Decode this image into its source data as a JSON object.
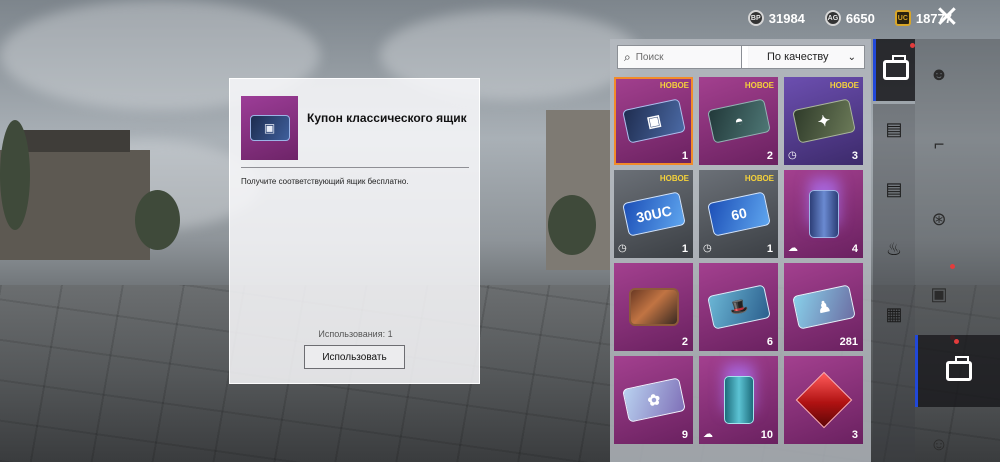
{
  "topbar": {
    "currencies": [
      {
        "icon": "bp-coin-icon",
        "code": "BP",
        "value": "31984"
      },
      {
        "icon": "silver-fragment-icon",
        "code": "AG",
        "value": "6650"
      },
      {
        "icon": "uc-coin-icon",
        "code": "UC",
        "value": "18777"
      }
    ],
    "close_icon": "close-icon"
  },
  "detail": {
    "title": "Купон классического ящик",
    "description": "Получите соответствующий ящик бесплатно.",
    "usage": "Использования: 1",
    "use_button": "Использовать"
  },
  "inventory": {
    "search_placeholder": "Поиск",
    "sort_label": "По качеству",
    "new_badge": "НОВОЕ",
    "items": [
      {
        "name": "classic-crate-coupon",
        "color": "purple",
        "art": "ticket t-classic",
        "glyph": "▣",
        "qty": "1",
        "new": true,
        "clock": false,
        "upload": false,
        "selected": true
      },
      {
        "name": "helmet-crate-coupon",
        "color": "purple",
        "art": "ticket t-green",
        "glyph": "◓",
        "qty": "2",
        "new": true,
        "clock": false,
        "upload": false,
        "selected": false
      },
      {
        "name": "army-crate-coupon",
        "color": "violet",
        "art": "ticket t-army",
        "glyph": "✦",
        "qty": "3",
        "new": true,
        "clock": true,
        "upload": false,
        "selected": false
      },
      {
        "name": "uc-voucher-30",
        "color": "gray",
        "art": "ticket t-uc",
        "glyph": "30UC",
        "qty": "1",
        "new": true,
        "clock": true,
        "upload": false,
        "selected": false
      },
      {
        "name": "uc-voucher-60",
        "color": "gray",
        "art": "ticket t-uc",
        "glyph": "60",
        "qty": "1",
        "new": true,
        "clock": true,
        "upload": false,
        "selected": false
      },
      {
        "name": "glowing-can",
        "color": "purple",
        "art": "can",
        "glyph": "",
        "qty": "4",
        "new": false,
        "clock": false,
        "upload": true,
        "selected": false
      },
      {
        "name": "vehicle-engine",
        "color": "purple",
        "art": "engine",
        "glyph": "",
        "qty": "2",
        "new": false,
        "clock": false,
        "upload": false,
        "selected": false
      },
      {
        "name": "fashion-ticket",
        "color": "purple",
        "art": "ticket t-fashion",
        "glyph": "🎩",
        "qty": "6",
        "new": false,
        "clock": false,
        "upload": false,
        "selected": false
      },
      {
        "name": "suit-ticket",
        "color": "purple",
        "art": "ticket t-suit",
        "glyph": "♟",
        "qty": "281",
        "new": false,
        "clock": false,
        "upload": false,
        "selected": false
      },
      {
        "name": "flower-ticket",
        "color": "purple",
        "art": "ticket t-flower",
        "glyph": "✿",
        "qty": "9",
        "new": false,
        "clock": false,
        "upload": false,
        "selected": false
      },
      {
        "name": "teal-glowing-can",
        "color": "purple",
        "art": "can teal",
        "glyph": "",
        "qty": "10",
        "new": false,
        "clock": false,
        "upload": true,
        "selected": false
      },
      {
        "name": "red-gem",
        "color": "purple",
        "art": "gem",
        "glyph": "",
        "qty": "3",
        "new": false,
        "clock": false,
        "upload": false,
        "selected": false
      }
    ]
  },
  "rail": {
    "tabs": [
      {
        "name": "tab-crates",
        "icon": "crate-icon"
      },
      {
        "name": "tab-character",
        "icon": "character-icon"
      },
      {
        "name": "tab-weapons",
        "icon": "pistol-icon"
      },
      {
        "name": "tab-vehicles",
        "icon": "steering-wheel-icon"
      },
      {
        "name": "tab-outfits",
        "icon": "outfit-icon"
      },
      {
        "name": "tab-inventory",
        "icon": "inventory-box-icon"
      },
      {
        "name": "tab-social",
        "icon": "social-icon"
      }
    ]
  }
}
